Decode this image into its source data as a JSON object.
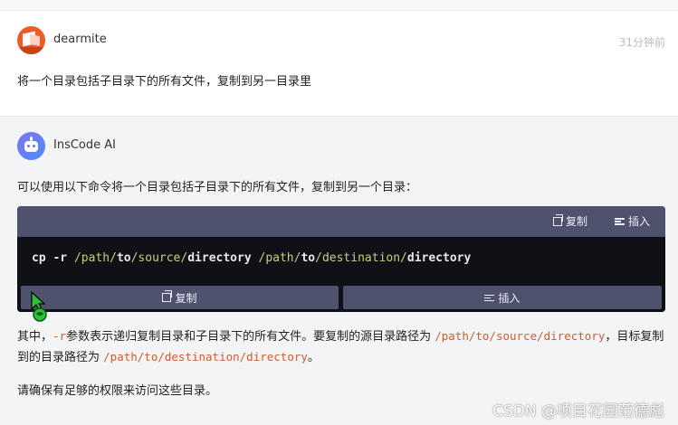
{
  "user_message": {
    "name": "dearmite",
    "time": "31分钟前",
    "text": "将一个目录包括子目录下的所有文件，复制到另一目录里"
  },
  "ai_message": {
    "name": "InsCode AI",
    "intro": "可以使用以下命令将一个目录包括子目录下的所有文件，复制到另一个目录：",
    "code": {
      "toolbar_copy": "复制",
      "toolbar_insert": "插入",
      "tokens": [
        {
          "t": "cp -r ",
          "k": "norm"
        },
        {
          "t": "/path/",
          "k": "path"
        },
        {
          "t": "to",
          "k": "norm"
        },
        {
          "t": "/source/",
          "k": "path"
        },
        {
          "t": "directory ",
          "k": "norm"
        },
        {
          "t": "/path/",
          "k": "path"
        },
        {
          "t": "to",
          "k": "norm"
        },
        {
          "t": "/destination/",
          "k": "path"
        },
        {
          "t": "directory",
          "k": "norm"
        }
      ],
      "bottom_copy": "复制",
      "bottom_insert": "插入"
    },
    "explain": {
      "p1": "其中，",
      "flag": "-r",
      "p2": "参数表示递归复制目录和子目录下的所有文件。要复制的源目录路径为 ",
      "src": "/path/to/source/directory",
      "p3": "，目标复制到的目录路径为 ",
      "dst": "/path/to/destination/directory",
      "p4": "。"
    },
    "note": "请确保有足够的权限来访问这些目录。"
  },
  "watermark": "CSDN @项目花园范德彪",
  "colors": {
    "code_bg": "#0f1117",
    "toolbar_bg": "#4f526d",
    "path_token": "#c8cd7a",
    "inline_code": "#d35b2b",
    "user_avatar": "#f05a24"
  },
  "icons": [
    "copy-icon",
    "insert-icon",
    "mouse-cursor-icon"
  ]
}
